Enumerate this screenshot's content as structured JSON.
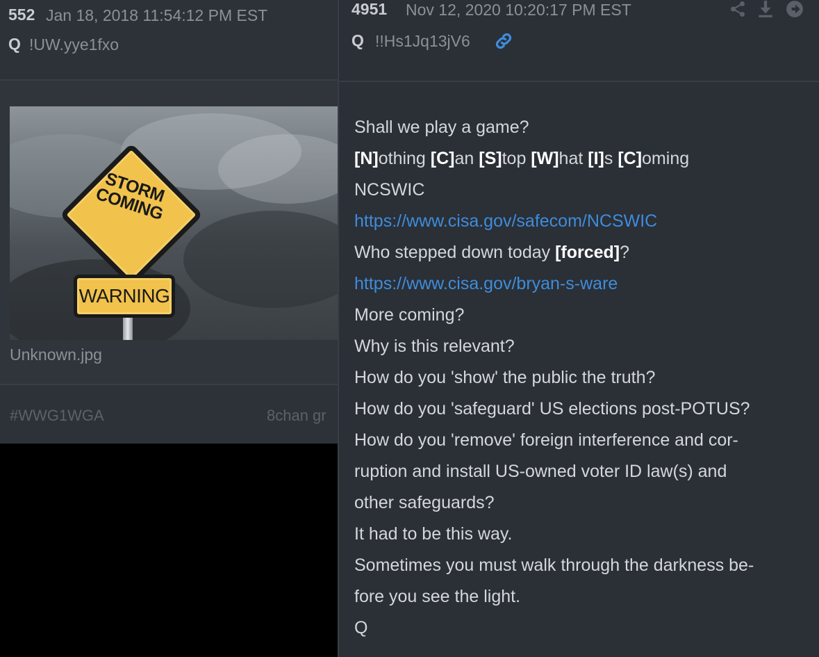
{
  "left_post": {
    "number": "552",
    "date": "Jan 18, 2018 11:54:12 PM EST",
    "author": "Q",
    "tripcode": "!UW.yye1fxo",
    "image": {
      "sign_text_line1": "STORM",
      "sign_text_line2": "COMING",
      "warning_text": "WARNING",
      "filename": "Unknown.jpg"
    },
    "hashtag": "#WWG1WGA",
    "source": "8chan gr"
  },
  "right_post": {
    "number": "4951",
    "date": "Nov 12, 2020 10:20:17 PM EST",
    "author": "Q",
    "tripcode": "!!Hs1Jq13jV6",
    "icons": [
      "link-icon",
      "share-icon",
      "download-icon",
      "arrow-right-icon"
    ],
    "message": {
      "l1": "Shall we play a game?",
      "l2": {
        "n": "[N]",
        "n_rest": "othing ",
        "c": "[C]",
        "c_rest": "an ",
        "s": "[S]",
        "s_rest": "top ",
        "w": "[W]",
        "w_rest": "hat ",
        "i": "[I]",
        "i_rest": "s ",
        "c2": "[C]",
        "c2_rest": "oming"
      },
      "l3": "NCSWIC",
      "l4_link": "https://www.cisa.gov/safecom/NCSWIC",
      "l5": {
        "pre": "Who stepped down today ",
        "bold": "[forced]",
        "post": "?"
      },
      "l6_link": "https://www.cisa.gov/bryan-s-ware",
      "l7": "More coming?",
      "l8": "Why is this relevant?",
      "l9": "How do you 'show' the public the truth?",
      "l10": "How do you 'safeguard' US elections post-POTUS?",
      "l11": "How do you 'remove' foreign interference and cor-",
      "l12": "ruption and install US-owned voter ID law(s) and",
      "l13": "other safeguards?",
      "l14": "It had to be this way.",
      "l15": "Sometimes you must walk through the darkness be-",
      "l16": "fore you see the light.",
      "l17": "Q"
    }
  },
  "colors": {
    "card_bg": "#2b2f36",
    "text": "#d4d7db",
    "muted": "#8c9097",
    "link": "#3d8ddc",
    "sign_yellow": "#f1c24c"
  }
}
